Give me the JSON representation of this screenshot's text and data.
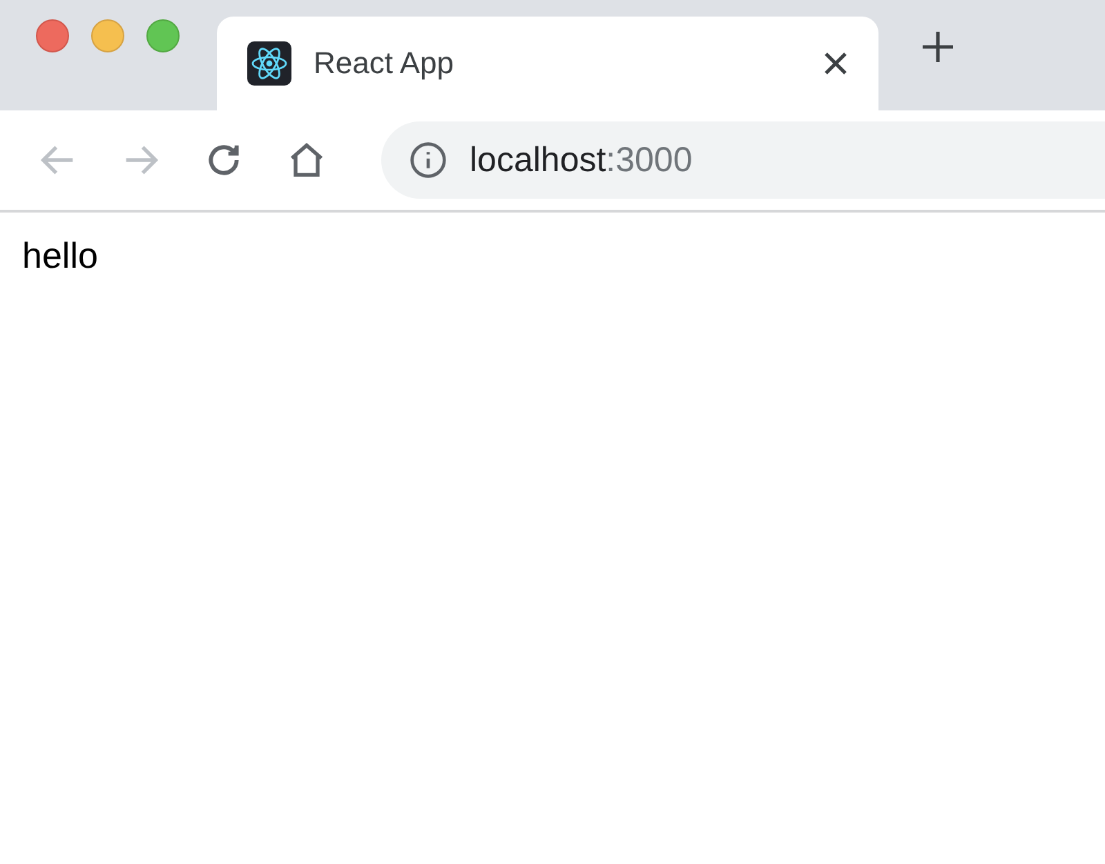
{
  "tabs": [
    {
      "title": "React App",
      "selected": true
    }
  ],
  "toolbar": {
    "back_disabled": true,
    "forward_disabled": true
  },
  "address": {
    "host": "localhost",
    "port": ":3000"
  },
  "page": {
    "text": "hello"
  }
}
